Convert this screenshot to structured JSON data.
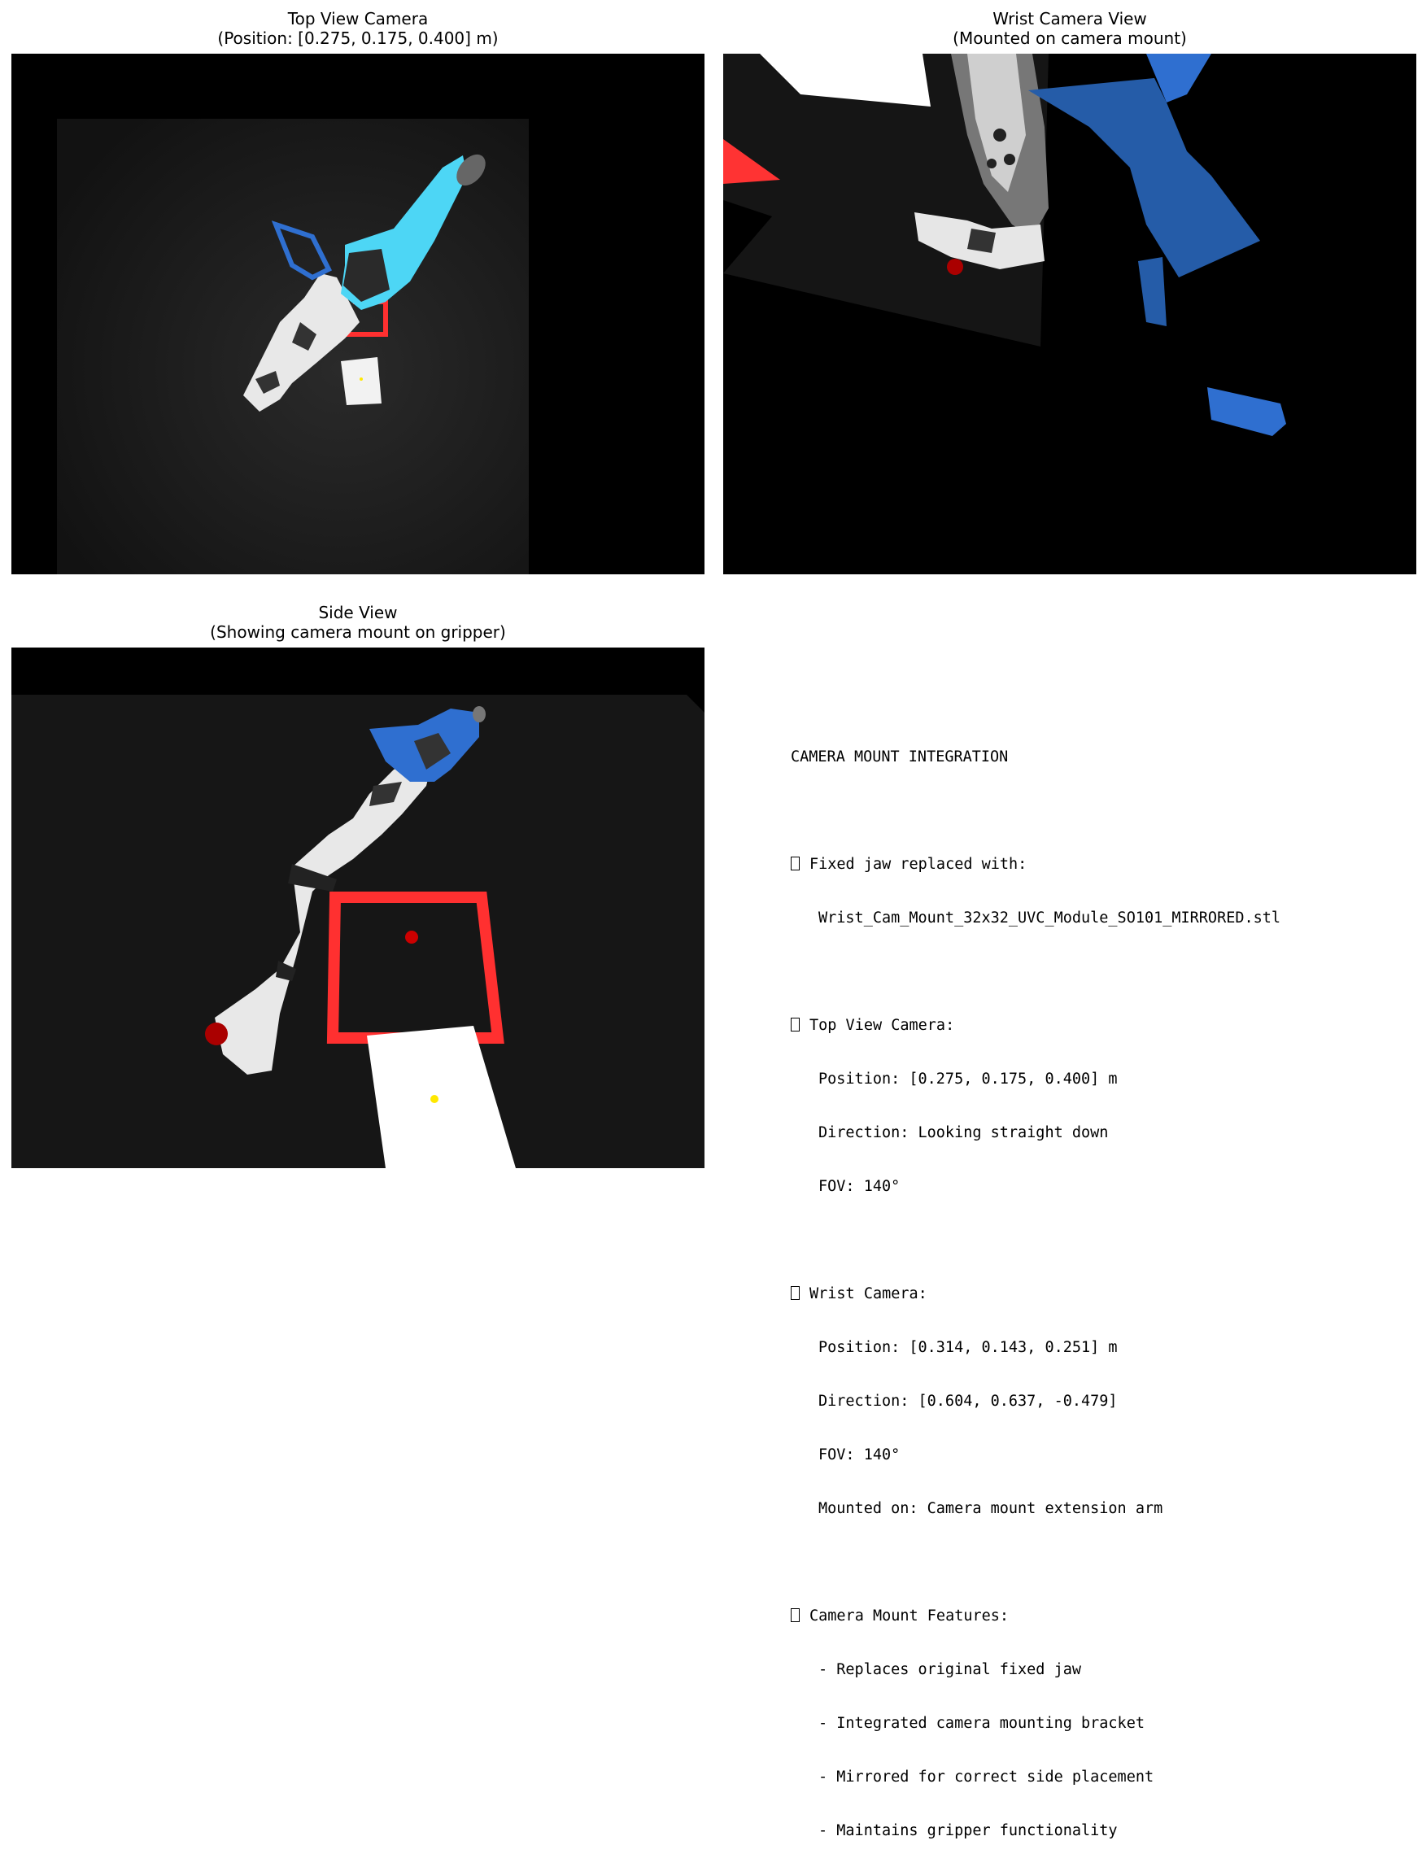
{
  "panels": {
    "top_view": {
      "title": "Top View Camera",
      "subtitle": "(Position: [0.275, 0.175, 0.400] m)"
    },
    "wrist_view": {
      "title": "Wrist Camera View",
      "subtitle": "(Mounted on camera mount)"
    },
    "side_view": {
      "title": "Side View",
      "subtitle": "(Showing camera mount on gripper)"
    }
  },
  "info": {
    "heading": "CAMERA MOUNT INTEGRATION",
    "fixed_jaw": {
      "label": "Fixed jaw replaced with:",
      "value": "Wrist_Cam_Mount_32x32_UVC_Module_SO101_MIRRORED.stl"
    },
    "top_camera": {
      "label": "Top View Camera:",
      "position": "Position: [0.275, 0.175, 0.400] m",
      "direction": "Direction: Looking straight down",
      "fov": "FOV: 140°"
    },
    "wrist_camera": {
      "label": "Wrist Camera:",
      "position": "Position: [0.314, 0.143, 0.251] m",
      "direction": "Direction: [0.604, 0.637, -0.479]",
      "fov": "FOV: 140°",
      "mounted_on": "Mounted on: Camera mount extension arm"
    },
    "features": {
      "label": "Camera Mount Features:",
      "items": [
        "- Replaces original fixed jaw",
        "- Integrated camera mounting bracket",
        "- Mirrored for correct side placement",
        "- Maintains gripper functionality"
      ]
    }
  },
  "colors": {
    "cyan_mount": "#4dd6f5",
    "blue_mount": "#2f6fd0",
    "target_red": "#ff2a2a",
    "floor": "#141414"
  }
}
